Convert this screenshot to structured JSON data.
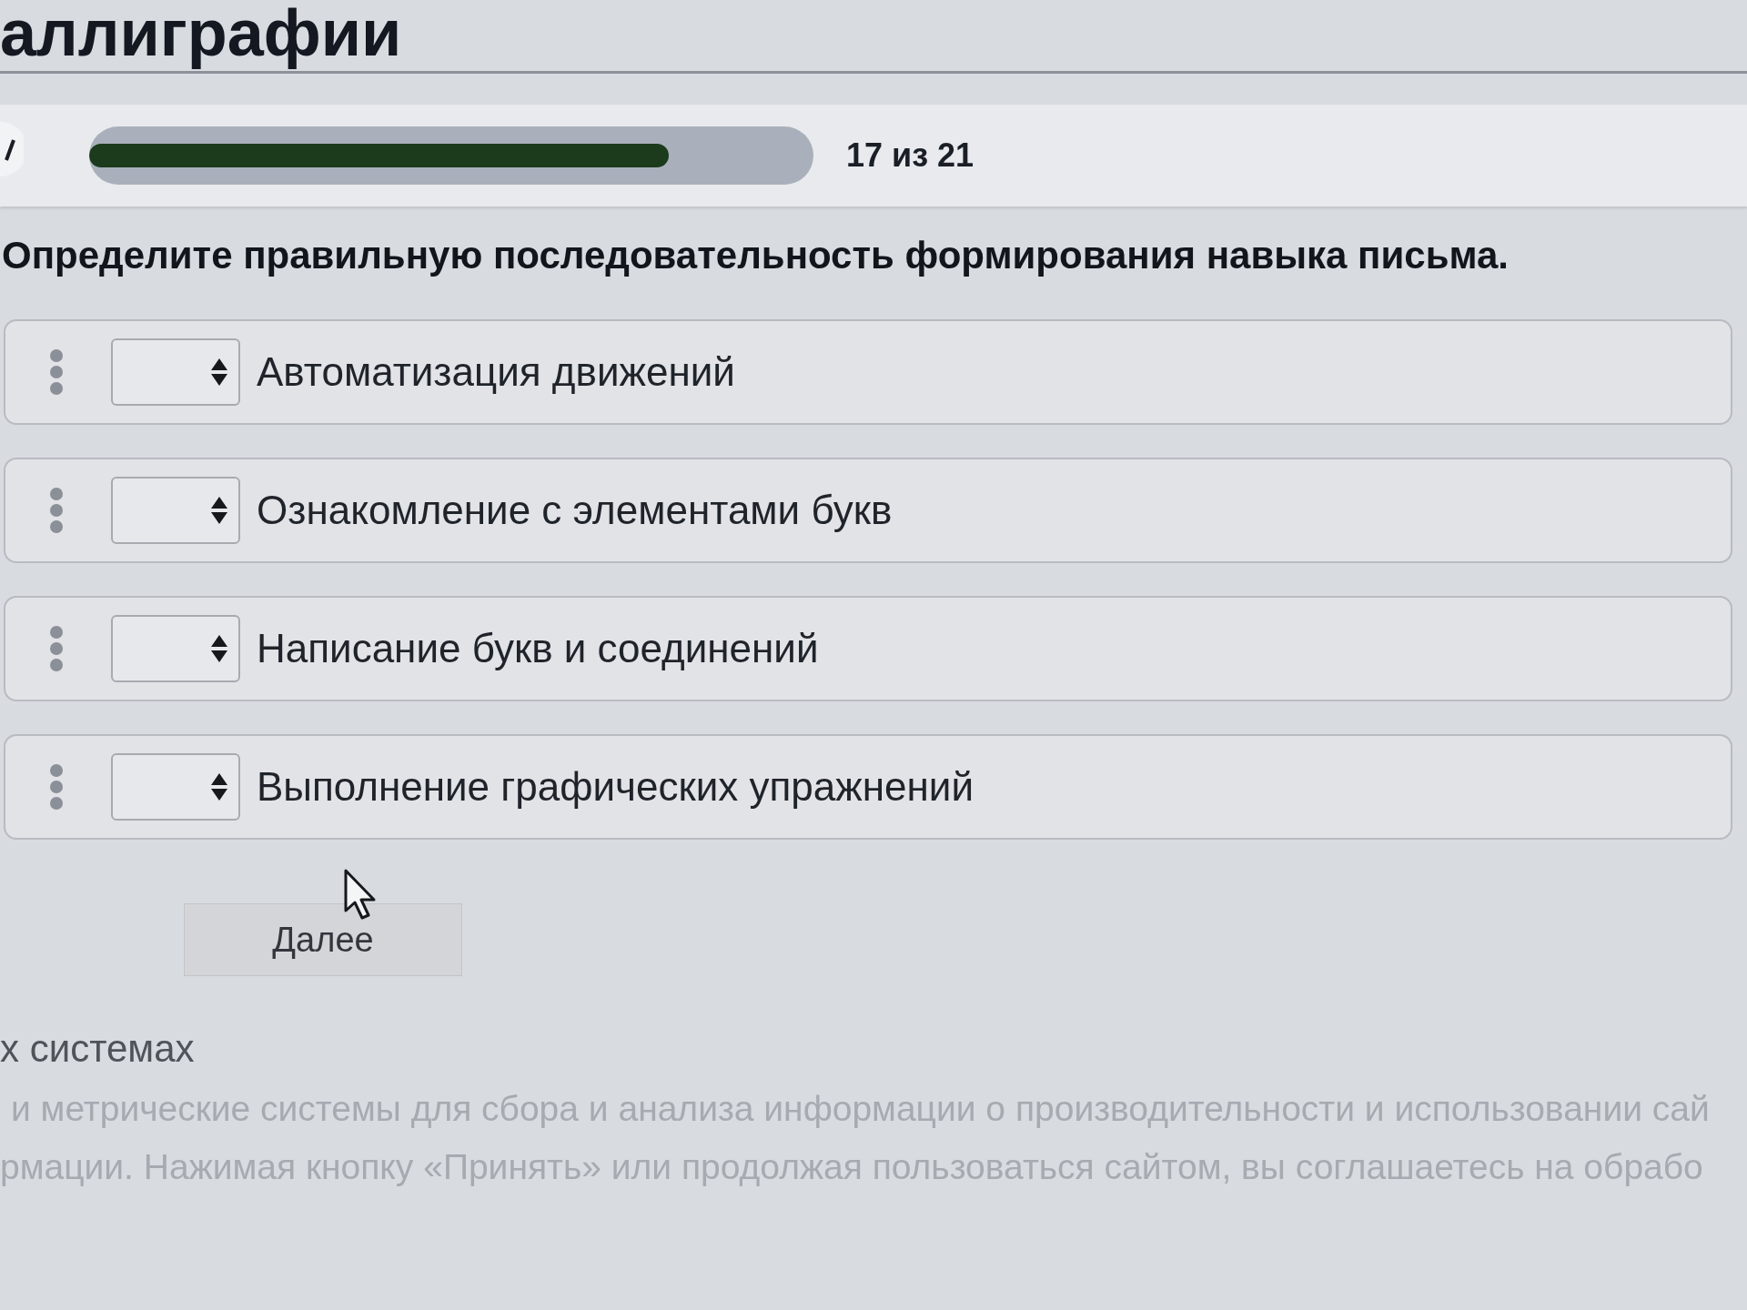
{
  "header": {
    "title": "аллиграфии"
  },
  "progress": {
    "level": 0.8,
    "counter": "17 из 21"
  },
  "question": {
    "text": "Определите правильную последовательность формирования навыка письма."
  },
  "answers": [
    {
      "label": "Автоматизация движений"
    },
    {
      "label": "Ознакомление с элементами букв"
    },
    {
      "label": "Написание букв и соединений"
    },
    {
      "label": "Выполнение графических упражнений"
    }
  ],
  "next_button": {
    "label": "Далее"
  },
  "cookie_notice": {
    "heading": "х системах",
    "lines": [
      "и метрические системы для сбора и анализа информации о производительности и использовании сай",
      "рмации. Нажимая кнопку «Принять» или продолжая пользоваться сайтом, вы соглашаетесь на обрабо"
    ]
  }
}
